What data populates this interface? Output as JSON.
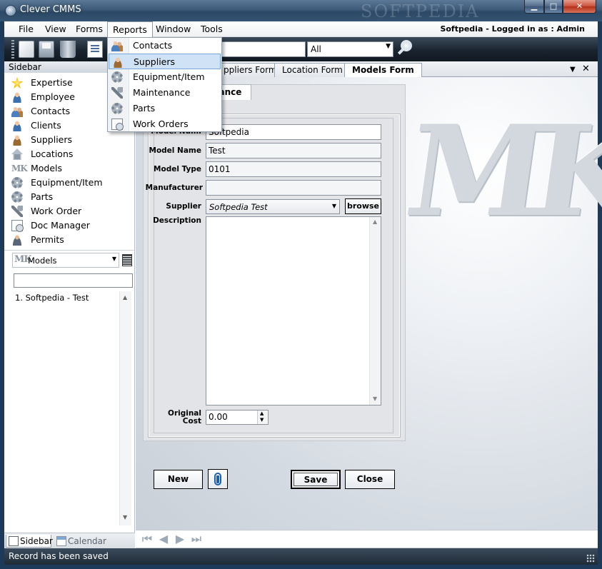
{
  "window": {
    "title": "Clever CMMS",
    "watermark": "SOFTPEDIA",
    "min_label": "▁",
    "max_label": "□",
    "close_label": "✕"
  },
  "menubar": {
    "items": [
      "File",
      "View",
      "Forms",
      "Reports",
      "Window",
      "Tools"
    ],
    "logged_in": "Softpedia - Logged in as :  Admin"
  },
  "reports_menu": {
    "items": [
      {
        "label": "Contacts",
        "icon": "contacts-icon"
      },
      {
        "label": "Suppliers",
        "icon": "supplier-icon"
      },
      {
        "label": "Equipment/Item",
        "icon": "equipment-icon"
      },
      {
        "label": "Maintenance",
        "icon": "maintenance-icon"
      },
      {
        "label": "Parts",
        "icon": "parts-icon"
      },
      {
        "label": "Work Orders",
        "icon": "work-order-icon"
      }
    ],
    "highlighted": "Suppliers"
  },
  "toolbar": {
    "search_value": "",
    "filter_value": "All"
  },
  "sidebar": {
    "title": "Sidebar",
    "items": [
      {
        "label": "Expertise",
        "icon": "star-icon"
      },
      {
        "label": "Employee",
        "icon": "employee-icon"
      },
      {
        "label": "Contacts",
        "icon": "contacts-icon"
      },
      {
        "label": "Clients",
        "icon": "clients-icon"
      },
      {
        "label": "Suppliers",
        "icon": "supplier-icon"
      },
      {
        "label": "Locations",
        "icon": "house-icon"
      },
      {
        "label": "Models",
        "icon": "mk-icon"
      },
      {
        "label": "Equipment/Item",
        "icon": "equipment-icon"
      },
      {
        "label": "Parts",
        "icon": "gear-icon"
      },
      {
        "label": "Work Order",
        "icon": "wrench-icon"
      },
      {
        "label": "Doc Manager",
        "icon": "document-icon"
      },
      {
        "label": "Permits",
        "icon": "permit-icon"
      }
    ],
    "combo_logo": "MK",
    "combo_value": "Models",
    "filter_value": "",
    "list": [
      "1. Softpedia - Test"
    ],
    "tabs": [
      "Sidebar",
      "Calendar"
    ]
  },
  "doc_tabs": {
    "items": [
      "ppliers Form",
      "Location Form",
      "Models Form"
    ],
    "active": "Models Form",
    "dropdown_label": "▼",
    "close_label": "✕"
  },
  "form": {
    "tab_label": "nance",
    "fields": {
      "model_num": {
        "label": "Model Num.",
        "value": "Softpedia"
      },
      "model_name": {
        "label": "Model Name",
        "value": "Test"
      },
      "model_type": {
        "label": "Model Type",
        "value": "0101"
      },
      "manufacturer": {
        "label": "Manufacturer",
        "value": ""
      },
      "supplier": {
        "label": "Supplier",
        "value": "Softpedia Test"
      },
      "description": {
        "label": "Description",
        "value": ""
      },
      "original_cost": {
        "label_line1": "Original",
        "label_line2": "Cost",
        "value": "0.00"
      }
    },
    "browse_label": "browse",
    "buttons": {
      "new": "New",
      "save": "Save",
      "close": "Close"
    },
    "watermark": "MK"
  },
  "navigator": {
    "first": "⏮",
    "prev": "◀",
    "next": "▶",
    "last": "⏭"
  },
  "status": {
    "message": "Record has been saved"
  }
}
